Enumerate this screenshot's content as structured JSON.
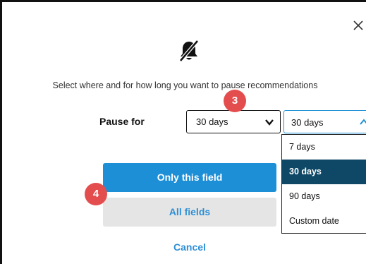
{
  "dialog": {
    "close_label": "×",
    "bell_icon": "bell-slash-icon",
    "instruction": "Select where and for how long you want to pause recommendations",
    "pause_label": "Pause for",
    "duration_select_value": "30 days",
    "duration_dropdown": {
      "selected_value": "30 days",
      "options": [
        "7 days",
        "30 days",
        "90 days",
        "Custom date"
      ],
      "highlighted_index": 1
    },
    "buttons": {
      "primary": "Only this field",
      "secondary": "All fields",
      "cancel": "Cancel"
    }
  },
  "annotations": {
    "step_3": "3",
    "step_4": "4"
  },
  "colors": {
    "primary_blue": "#1d8fd6",
    "selected_option_bg": "#0e4866",
    "secondary_button_bg": "#e5e5e5",
    "badge_red": "#e44d4d"
  }
}
